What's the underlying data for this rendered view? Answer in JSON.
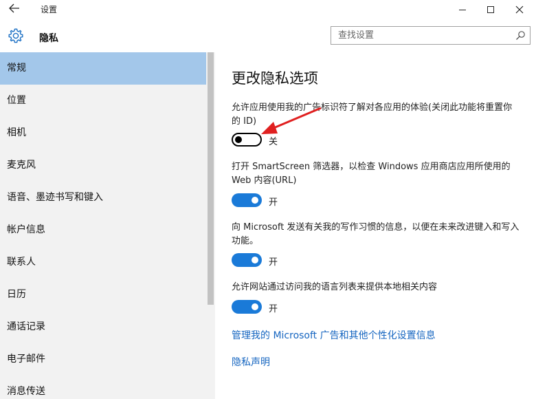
{
  "window": {
    "title": "设置",
    "back_icon": "back-arrow-icon",
    "controls": [
      "minimize-icon",
      "maximize-icon",
      "close-icon"
    ]
  },
  "header": {
    "title": "隐私",
    "icon": "gear-icon",
    "search": {
      "placeholder": "查找设置",
      "icon": "search-icon"
    }
  },
  "sidebar": {
    "items": [
      {
        "label": "常规",
        "selected": true
      },
      {
        "label": "位置"
      },
      {
        "label": "相机"
      },
      {
        "label": "麦克风"
      },
      {
        "label": "语音、墨迹书写和键入"
      },
      {
        "label": "帐户信息"
      },
      {
        "label": "联系人"
      },
      {
        "label": "日历"
      },
      {
        "label": "通话记录"
      },
      {
        "label": "电子邮件"
      },
      {
        "label": "消息传送"
      }
    ]
  },
  "main": {
    "title": "更改隐私选项",
    "settings": [
      {
        "desc": "允许应用使用我的广告标识符了解对各应用的体验(关闭此功能将重置你的 ID)",
        "on": false,
        "state": "关"
      },
      {
        "desc": "打开 SmartScreen 筛选器，以检查 Windows 应用商店应用所使用的 Web 内容(URL)",
        "on": true,
        "state": "开"
      },
      {
        "desc": "向 Microsoft 发送有关我的写作习惯的信息，以便在未来改进键入和写入功能。",
        "on": true,
        "state": "开"
      },
      {
        "desc": "允许网站通过访问我的语言列表来提供本地相关内容",
        "on": true,
        "state": "开"
      }
    ],
    "links": [
      "管理我的 Microsoft 广告和其他个性化设置信息",
      "隐私声明"
    ]
  },
  "colors": {
    "accent": "#1a7ad8",
    "selected_nav": "#a3c7ea",
    "sidebar_bg": "#f2f2f2",
    "link": "#1565c0",
    "annotation_arrow": "#e02020"
  }
}
